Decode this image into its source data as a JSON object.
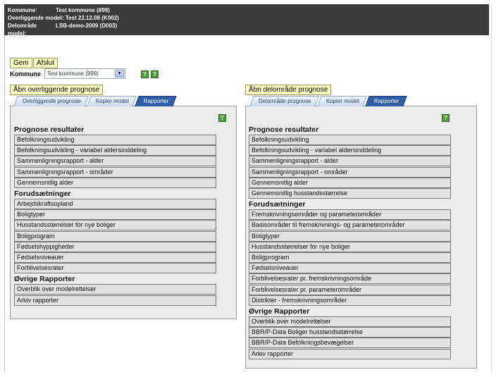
{
  "header": {
    "rows": [
      {
        "label": "Kommune:",
        "value": "Test kommune (899)"
      },
      {
        "label": "Overliggende model:",
        "value": "Test 22.12.08 (K002)"
      },
      {
        "label": "Delområde model:",
        "value": "LSB-demo-2009 (D003)"
      }
    ]
  },
  "toolbar": {
    "save_label": "Gem",
    "close_label": "Afslut"
  },
  "kommune": {
    "label": "Kommune",
    "selected": "Test kommune (899)"
  },
  "left": {
    "open_button": "Åbn overliggende prognose",
    "tabs": [
      "Overliggende prognose",
      "Kopier model",
      "Rapporter"
    ],
    "sections": [
      {
        "title": "Prognose resultater",
        "items": [
          "Befolkningsudvikling",
          "Befolkningsudvikling - variabel aldersinddeling",
          "Sammenligningsrapport - alder",
          "Sammenligningsrapport - områder",
          "Gennemsnitlig alder"
        ]
      },
      {
        "title": "Forudsætninger",
        "items": [
          "Arbejdskraftsopland",
          "Boligtyper",
          "Husstandsstørrelser for nye boliger",
          "Boligprogram",
          "Fødselshyppigheder",
          "Fødselsniveauer",
          "Forblivelsesrater"
        ]
      },
      {
        "title": "Øvrige Rapporter",
        "items": [
          "Overblik over modelrettelser",
          "Arkiv rapporter"
        ]
      }
    ]
  },
  "right": {
    "open_button": "Åbn delområde prognose",
    "tabs": [
      "Delområde prognose",
      "Kopier model",
      "Rapporter"
    ],
    "sections": [
      {
        "title": "Prognose resultater",
        "items": [
          "Befolkningsudvikling",
          "Befolkningsudvikling - variabel aldersinddeling",
          "Sammenligningsrapport - alder",
          "Sammenligningsrapport - områder",
          "Gennemsnitlig alder",
          "Gennemsnitlig husstandsstørrelse"
        ]
      },
      {
        "title": "Forudsætninger",
        "items": [
          "Fremskrivningsområder og parameterområder",
          "Basisområder til fremskrivnings- og parameterområder",
          "Boligtyper",
          "Husstandsstørrelser for nye boliger",
          "Boligprogram",
          "Fødselsniveauer",
          "Forblivelsesrater pr. fremskrivningsområde",
          "Forblivelsesrater pr. parameterområder",
          "Distrikter - fremskrivningsområder"
        ]
      },
      {
        "title": "Øvrige Rapporter",
        "items": [
          "Overblik over modelrettelser",
          "BBR/P-Data Boliger husstandsstørrelse",
          "BBR/P-Data Befolkningsbevægelser",
          "Arkiv rapporter"
        ]
      }
    ]
  },
  "help_icon_glyph": "?"
}
